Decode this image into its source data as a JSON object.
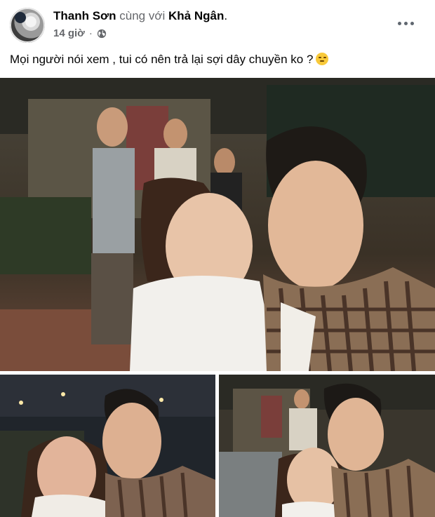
{
  "post": {
    "author": "Thanh Sơn",
    "with_text": "cùng với",
    "tagged": "Khả Ngân",
    "period": ".",
    "time": "14 giờ",
    "separator": "·",
    "privacy_icon": "globe-icon",
    "more_icon": "more-options-icon",
    "caption": "Mọi người nói xem , tui có nên trả lại sợi dây chuyền ko  ?",
    "caption_emoji": "pensive-face-emoji"
  },
  "photos": {
    "count": 3,
    "layout": "one-large-two-small"
  },
  "colors": {
    "text_primary": "#050505",
    "text_secondary": "#65676b",
    "icon_gray": "#606770",
    "background": "#ffffff"
  }
}
